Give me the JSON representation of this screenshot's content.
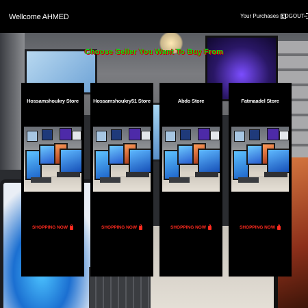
{
  "header": {
    "brand": "Wellcome AHMED",
    "purchases_label": "Your Purchases",
    "logout_label": "LOGOUT"
  },
  "headline": "Choose Seller You Want To Buy From",
  "stores": [
    {
      "name": "Hossamshoukry Store",
      "button_label": "SHOPPING NOW"
    },
    {
      "name": "Hossamshoukry51 Store",
      "button_label": "SHOPPING NOW"
    },
    {
      "name": "Abdo Store",
      "button_label": "SHOPPING NOW"
    },
    {
      "name": "Fatmaadel Store",
      "button_label": "SHOPPING NOW"
    }
  ],
  "colors": {
    "header_bg": "#000000",
    "headline_green": "#00e21a",
    "headline_shadow": "#d00000",
    "button_red": "#ff2a1e",
    "card_bg": "#000000"
  },
  "icons": {
    "purchases": "bag-icon",
    "logout": "logout-icon",
    "shop": "cart-icon"
  }
}
